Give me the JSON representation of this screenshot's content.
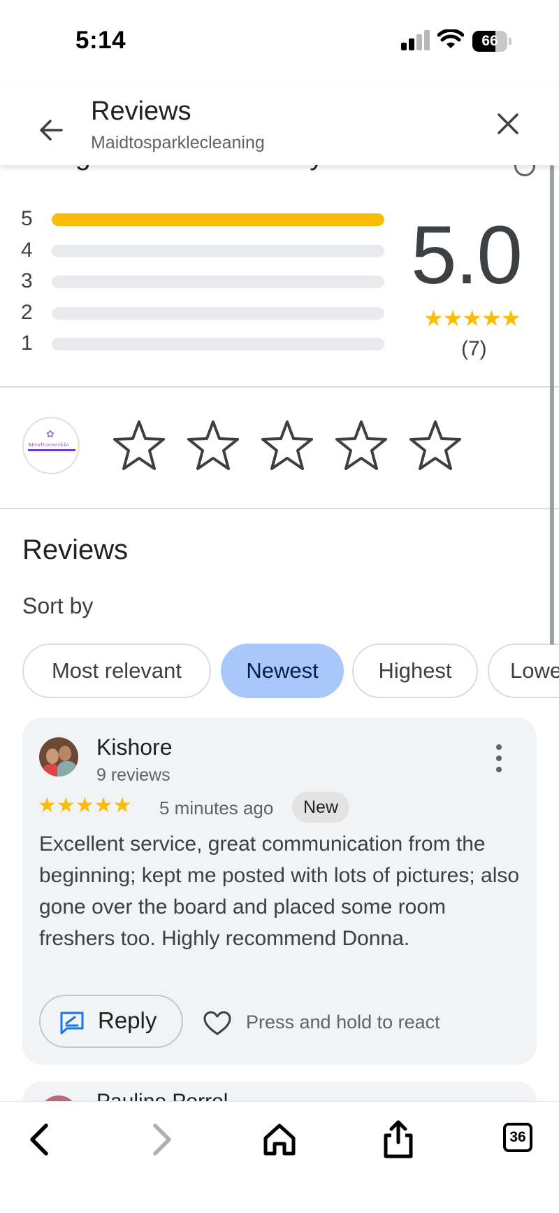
{
  "status_bar": {
    "time": "5:14",
    "battery": "66",
    "battery_level": 0.66
  },
  "header": {
    "title": "Reviews",
    "subtitle": "Maidtosparklecleaning"
  },
  "summary": {
    "title": "Google review summary",
    "distribution": [
      {
        "stars": "5",
        "fraction": 1.0
      },
      {
        "stars": "4",
        "fraction": 0.0
      },
      {
        "stars": "3",
        "fraction": 0.0
      },
      {
        "stars": "2",
        "fraction": 0.0
      },
      {
        "stars": "1",
        "fraction": 0.0
      }
    ],
    "average": "5.0",
    "stars": "★★★★★",
    "count": "(7)"
  },
  "rate": {
    "stars_total": 5,
    "stars_filled": 0
  },
  "reviews": {
    "heading": "Reviews",
    "sort_label": "Sort by",
    "sort_options": [
      {
        "label": "Most relevant",
        "active": false
      },
      {
        "label": "Newest",
        "active": true
      },
      {
        "label": "Highest",
        "active": false
      },
      {
        "label": "Lowest",
        "active": false
      }
    ],
    "items": [
      {
        "name": "Kishore",
        "meta": "9 reviews",
        "stars": "★★★★★",
        "time": "5 minutes ago",
        "badge": "New",
        "text": "Excellent service, great communication from the beginning; kept me posted with lots of pictures; also gone over the board and placed some room freshers too. Highly recommend Donna.",
        "reply_label": "Reply",
        "react_text": "Press and hold to react"
      },
      {
        "name": "Pauline Perrel"
      }
    ]
  },
  "toolbar": {
    "tabs_count": "36"
  },
  "colors": {
    "star": "#fbbc04",
    "chip_active": "#a8c7fa",
    "accent_blue": "#1a73e8"
  }
}
